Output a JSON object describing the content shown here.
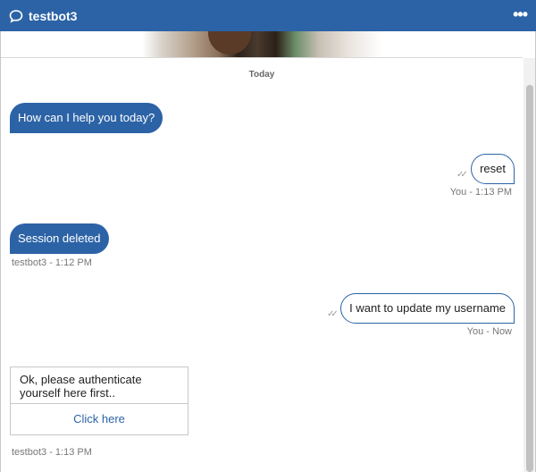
{
  "header": {
    "title": "testbot3",
    "menu_label": "•••"
  },
  "conversation": {
    "date_separator": "Today",
    "messages": [
      {
        "sender": "bot",
        "text": "How can I help you today?"
      },
      {
        "sender": "user",
        "text": "reset",
        "meta": "You - 1:13 PM"
      },
      {
        "sender": "bot",
        "text": "Session deleted",
        "meta": "testbot3 - 1:12 PM"
      },
      {
        "sender": "user",
        "text": "I want to update my username",
        "meta": "You - Now"
      }
    ],
    "card": {
      "text": "Ok, please authenticate yourself here first..",
      "button_label": "Click here",
      "meta": "testbot3 - 1:13 PM"
    }
  },
  "colors": {
    "accent": "#2c63a6",
    "muted_text": "#777777"
  },
  "icons": {
    "header_icon": "chat-bubble-icon",
    "delivered": "double-check-icon",
    "menu": "more-horizontal-icon"
  }
}
